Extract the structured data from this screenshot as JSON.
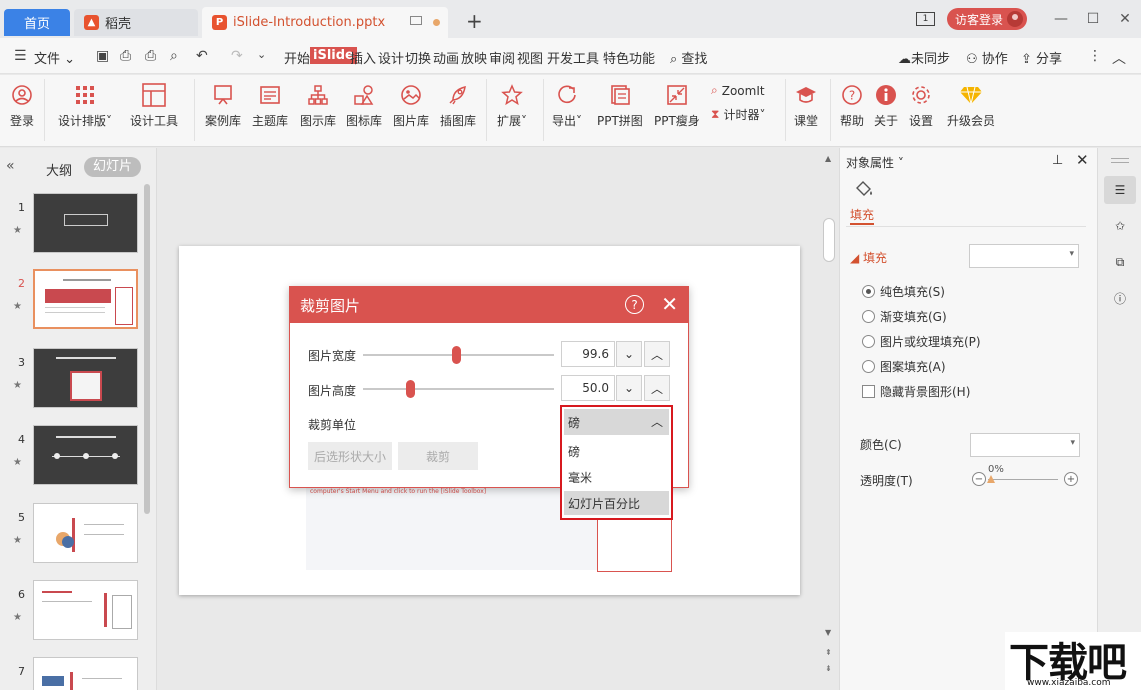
{
  "titlebar": {
    "home_tab": "首页",
    "daoke_tab": "稻壳",
    "file_tab": "iSlide-Introduction.pptx",
    "page_indicator": "1",
    "guest_login": "访客登录"
  },
  "menu": {
    "file": "文件",
    "items": [
      "开始",
      "iSlide",
      "插入",
      "设计",
      "切换",
      "动画",
      "放映",
      "审阅",
      "视图",
      "开发工具",
      "特色功能"
    ],
    "search": "查找",
    "unsync": "未同步",
    "collab": "协作",
    "share": "分享"
  },
  "ribbon": {
    "login": "登录",
    "design_layout": "设计排版",
    "design_tools": "设计工具",
    "case_lib": "案例库",
    "theme_lib": "主题库",
    "diagram_lib": "图示库",
    "icon_lib": "图标库",
    "image_lib": "图片库",
    "illus_lib": "插图库",
    "extend": "扩展",
    "export": "导出",
    "ppt_collage": "PPT拼图",
    "ppt_slim": "PPT瘦身",
    "zoomit": "ZoomIt",
    "timer": "计时器",
    "classroom": "课堂",
    "help": "帮助",
    "about": "关于",
    "settings": "设置",
    "upgrade": "升级会员"
  },
  "leftpanel": {
    "outline_tab": "大纲",
    "slides_tab": "幻灯片",
    "slide_numbers": [
      "1",
      "2",
      "3",
      "4",
      "5",
      "6",
      "7"
    ],
    "selected_slide": "2"
  },
  "slide": {
    "caption": "computer's Start Menu and click to run the [iSlide Toolbox]"
  },
  "dialog": {
    "title": "裁剪图片",
    "width_label": "图片宽度",
    "width_value": "99.6",
    "height_label": "图片高度",
    "height_value": "50.0",
    "unit_label": "裁剪单位",
    "btn_shape_size": "后选形状大小",
    "btn_crop": "裁剪",
    "width_fraction": 0.49,
    "height_fraction": 0.25
  },
  "unit_dropdown": {
    "selected": "磅",
    "options": [
      "磅",
      "毫米",
      "幻灯片百分比"
    ],
    "highlighted": "幻灯片百分比"
  },
  "rightpanel": {
    "title": "对象属性",
    "tab_fill": "填充",
    "section_fill": "填充",
    "options": [
      "纯色填充(S)",
      "渐变填充(G)",
      "图片或纹理填充(P)",
      "图案填充(A)"
    ],
    "hide_bg": "隐藏背景图形(H)",
    "color_label": "颜色(C)",
    "transparency_label": "透明度(T)",
    "transparency_value": "0%"
  },
  "watermark": {
    "text": "下载吧",
    "url": "www.xiazaiba.com"
  },
  "colors": {
    "accent": "#d9534f",
    "home_tab": "#3b82e6",
    "dropdown_highlight": "#d7191f"
  }
}
